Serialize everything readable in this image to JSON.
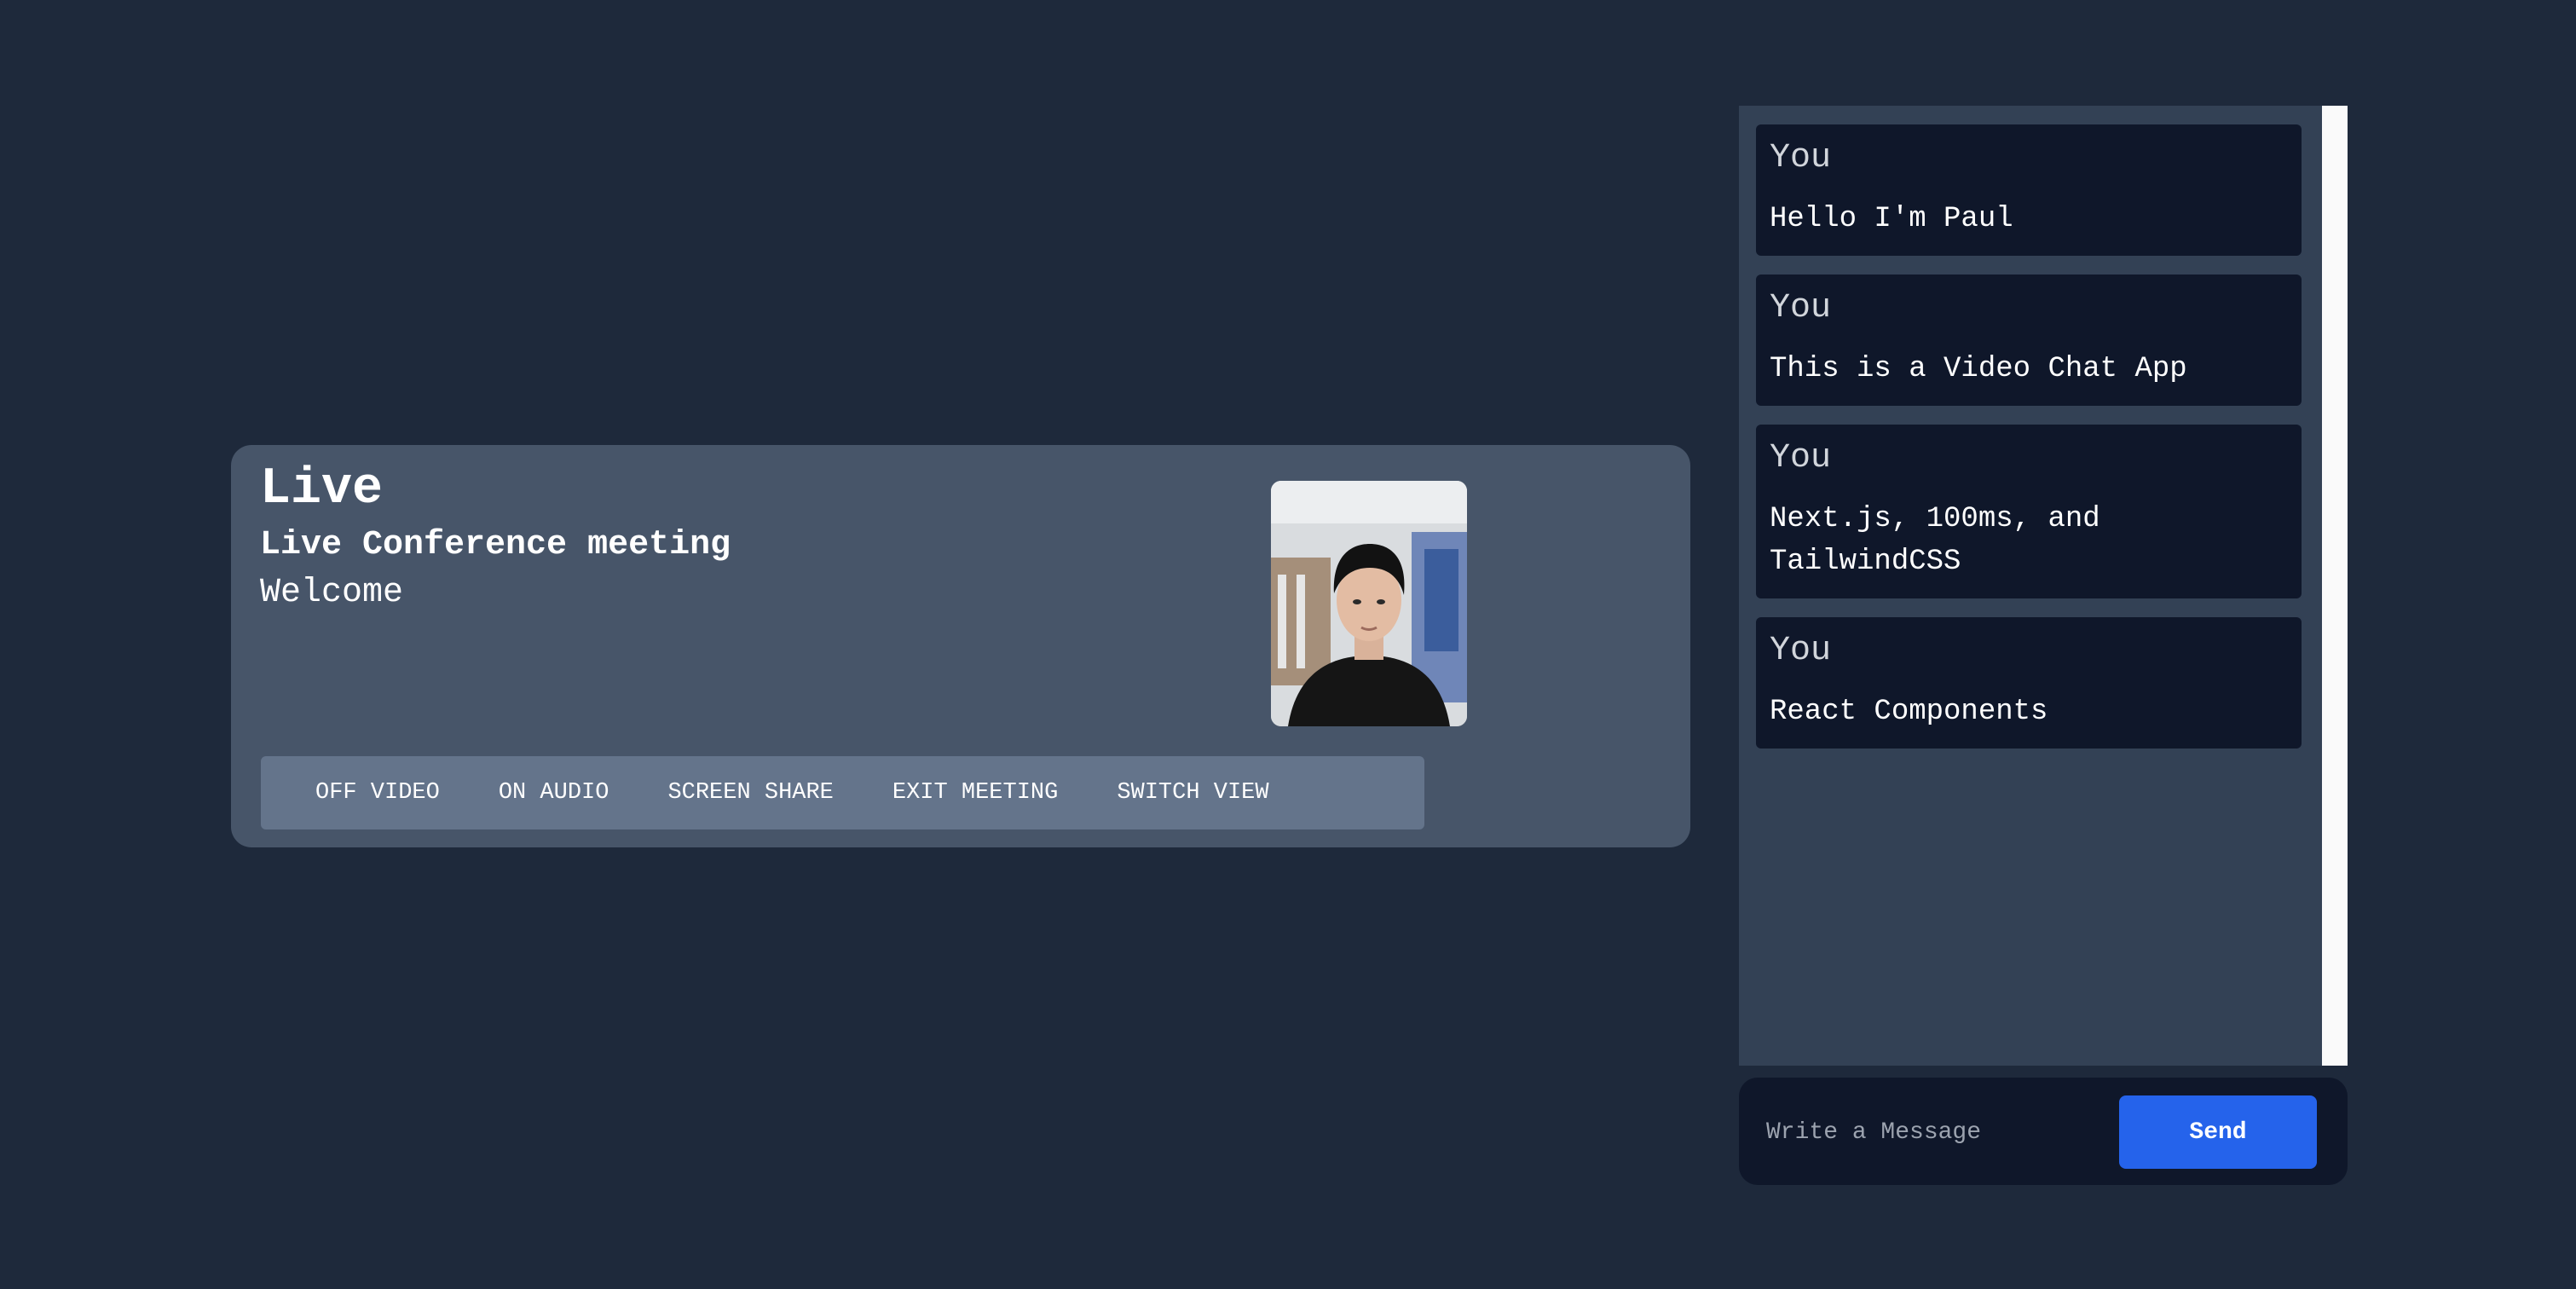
{
  "meeting": {
    "title": "Live",
    "subtitle": "Live Conference meeting",
    "welcome": "Welcome"
  },
  "controls": {
    "video_label": "OFF VIDEO",
    "audio_label": "ON AUDIO",
    "screen_share_label": "SCREEN SHARE",
    "exit_label": "EXIT MEETING",
    "switch_view_label": "SWITCH VIEW"
  },
  "chat": {
    "messages": [
      {
        "sender": "You",
        "text": "Hello I'm Paul"
      },
      {
        "sender": "You",
        "text": "This is a Video Chat App"
      },
      {
        "sender": "You",
        "text": "Next.js, 100ms, and TailwindCSS"
      },
      {
        "sender": "You",
        "text": "React Components"
      }
    ],
    "input_placeholder": "Write a Message",
    "send_label": "Send"
  },
  "colors": {
    "page_background": "#1e293b",
    "card_background": "#475569",
    "controls_background": "#64748b",
    "chat_panel_background": "#334155",
    "message_background": "#0f172a",
    "send_button": "#2563eb"
  }
}
